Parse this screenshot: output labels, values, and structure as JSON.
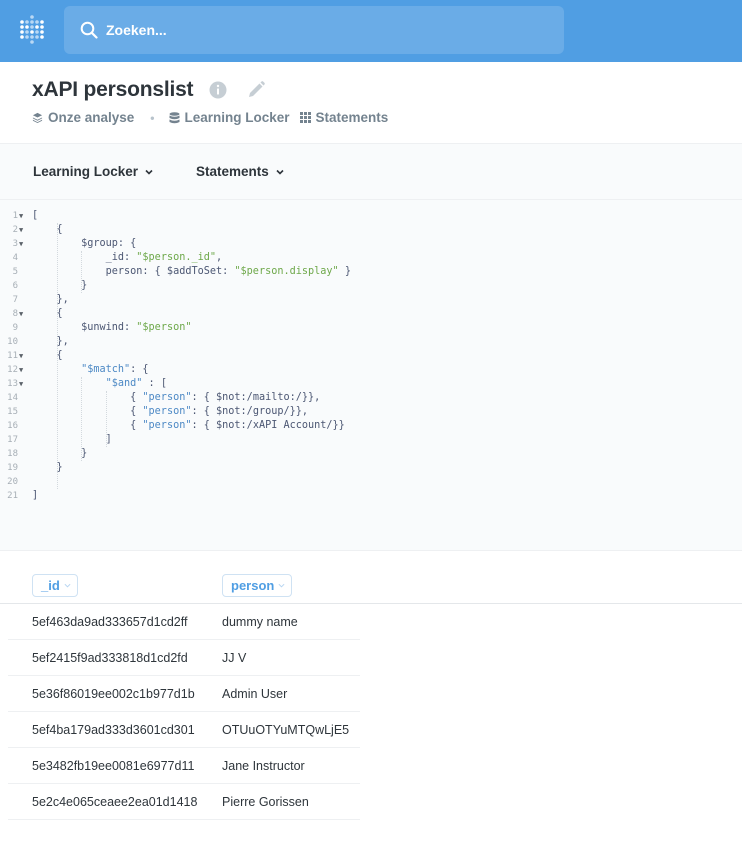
{
  "topbar": {
    "search_placeholder": "Zoeken..."
  },
  "header": {
    "title": "xAPI personslist",
    "breadcrumbs": [
      "Onze analyse",
      "Learning Locker",
      "Statements"
    ]
  },
  "selectors": {
    "database": "Learning Locker",
    "table": "Statements"
  },
  "editor": {
    "line_numbers": [
      "1",
      "2",
      "3",
      "4",
      "5",
      "6",
      "7",
      "8",
      "9",
      "10",
      "11",
      "12",
      "13",
      "14",
      "15",
      "16",
      "17",
      "18",
      "19",
      "20",
      "21"
    ],
    "lines": [
      "[",
      "    {",
      "        $group: {",
      "            _id: \"$person._id\",",
      "            person: { $addToSet: \"$person.display\" }",
      "        }",
      "    },",
      "    {",
      "        $unwind: \"$person\"",
      "    },",
      "    {",
      "        \"$match\": {",
      "            \"$and\" : [",
      "                { \"person\": { $not:/mailto:/}},",
      "                { \"person\": { $not:/group/}},",
      "                { \"person\": { $not:/xAPI Account/}}",
      "            ]",
      "        }",
      "    }",
      "",
      "]"
    ]
  },
  "results": {
    "columns": [
      "_id",
      "person"
    ],
    "rows": [
      {
        "id": "5ef463da9ad333657d1cd2ff",
        "person": "dummy name"
      },
      {
        "id": "5ef2415f9ad333818d1cd2fd",
        "person": "JJ V"
      },
      {
        "id": "5e36f86019ee002c1b977d1b",
        "person": "Admin User"
      },
      {
        "id": "5ef4ba179ad333d3601cd301",
        "person": "OTUuOTYuMTQwLjE5"
      },
      {
        "id": "5e3482fb19ee0081e6977d11",
        "person": "Jane Instructor"
      },
      {
        "id": "5e2c4e065ceaee2ea01d1418",
        "person": "Pierre Gorissen"
      }
    ]
  },
  "colors": {
    "brand": "#509ee3",
    "string": "#6ea84a",
    "key": "#4d89c5"
  }
}
